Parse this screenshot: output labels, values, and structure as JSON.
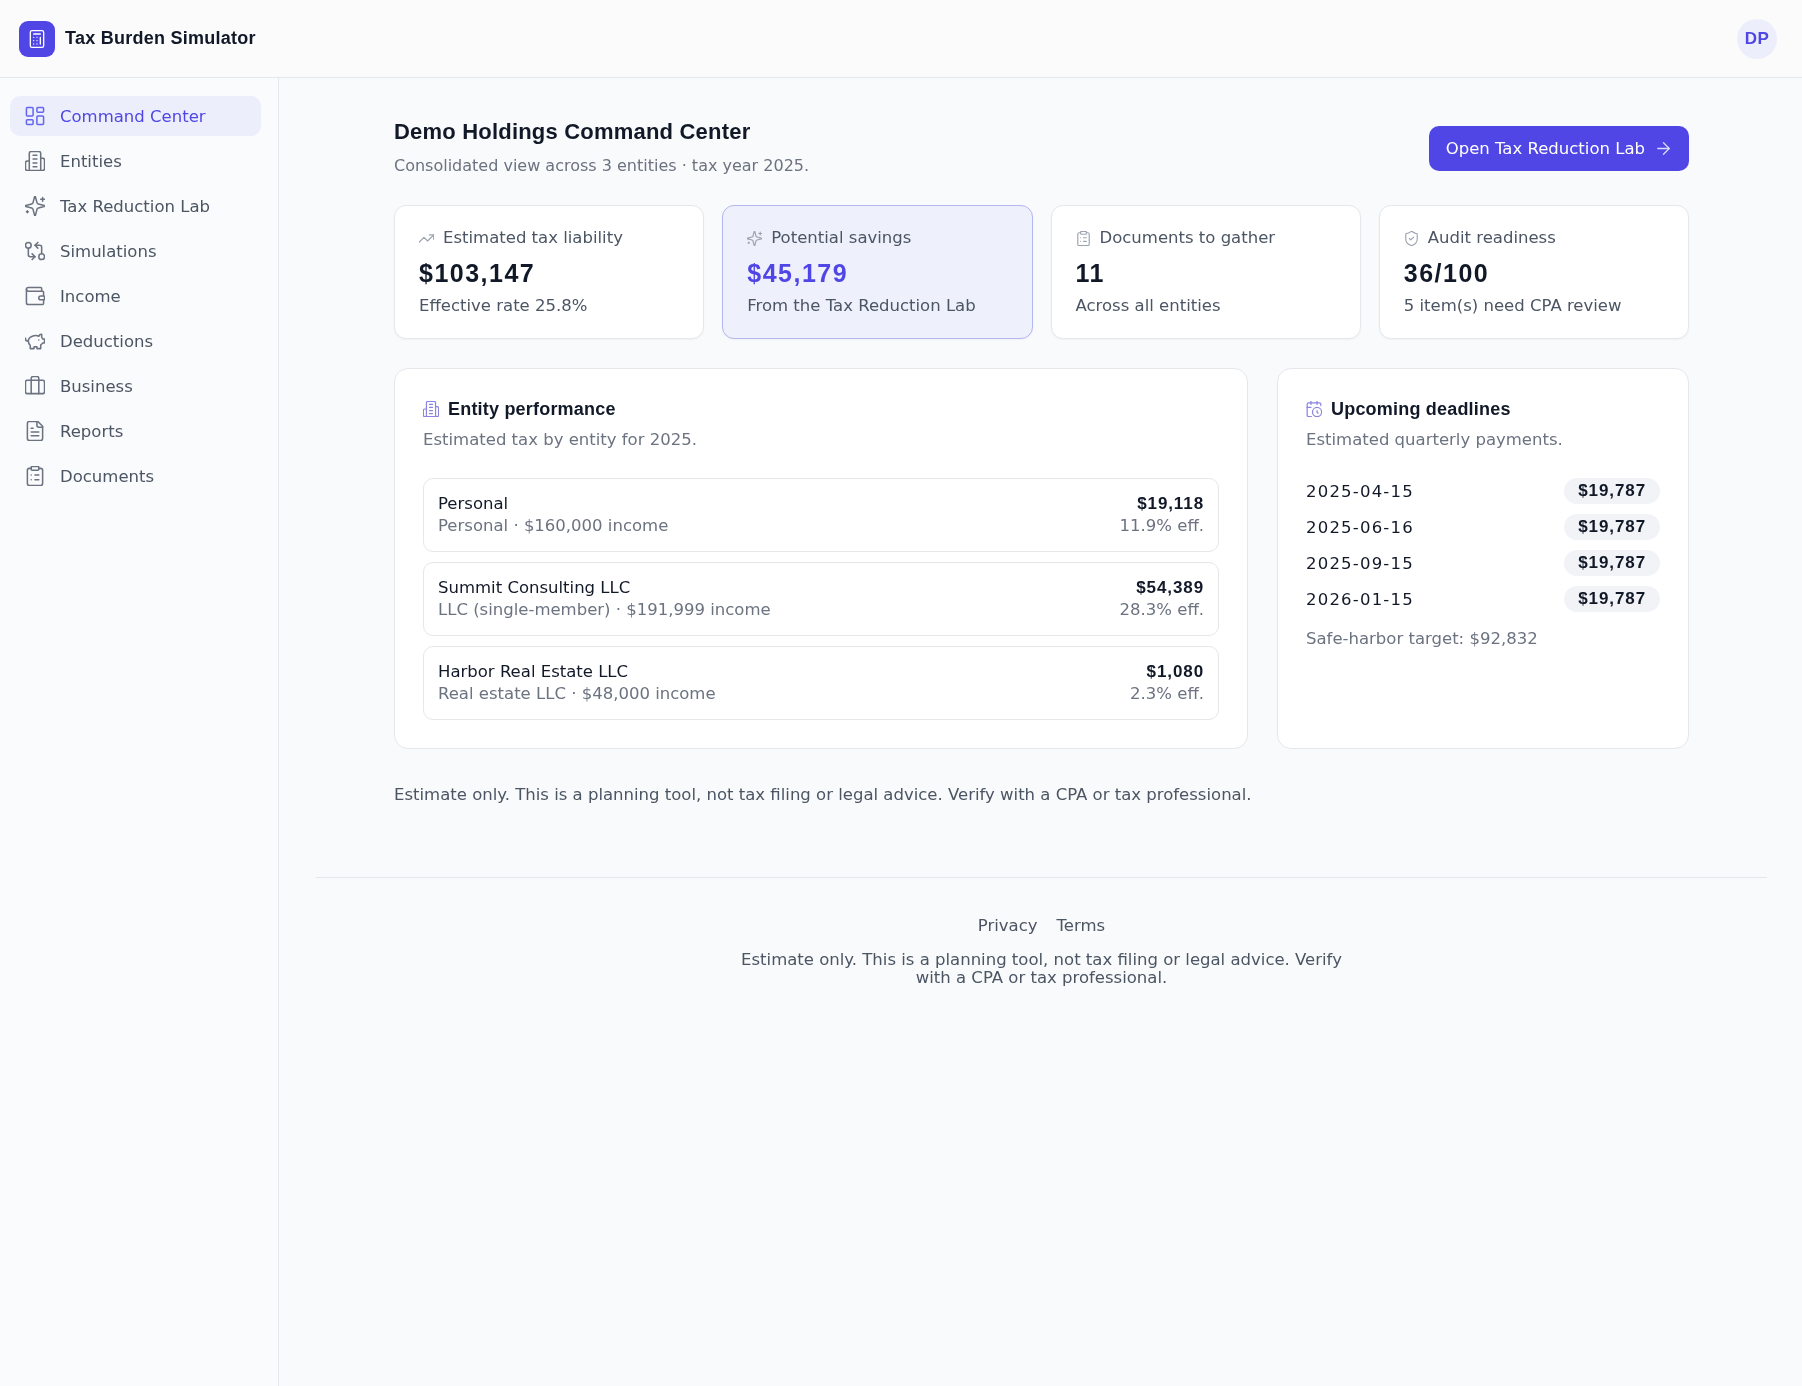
{
  "header": {
    "app_title": "Tax Burden Simulator",
    "avatar_initials": "DP"
  },
  "sidebar": {
    "items": [
      {
        "label": "Command Center",
        "selected": true
      },
      {
        "label": "Entities",
        "selected": false
      },
      {
        "label": "Tax Reduction Lab",
        "selected": false
      },
      {
        "label": "Simulations",
        "selected": false
      },
      {
        "label": "Income",
        "selected": false
      },
      {
        "label": "Deductions",
        "selected": false
      },
      {
        "label": "Business",
        "selected": false
      },
      {
        "label": "Reports",
        "selected": false
      },
      {
        "label": "Documents",
        "selected": false
      }
    ]
  },
  "page": {
    "title": "Demo Holdings Command Center",
    "subtitle": "Consolidated view across 3 entities · tax year 2025.",
    "primary_button": "Open Tax Reduction Lab"
  },
  "stat_cards": [
    {
      "label": "Estimated tax liability",
      "value": "$103,147",
      "note": "Effective rate 25.8%",
      "highlighted": false
    },
    {
      "label": "Potential savings",
      "value": "$45,179",
      "note": "From the Tax Reduction Lab",
      "highlighted": true
    },
    {
      "label": "Documents to gather",
      "value": "11",
      "note": "Across all entities",
      "highlighted": false
    },
    {
      "label": "Audit readiness",
      "value": "36/100",
      "note": "5 item(s) need CPA review",
      "highlighted": false
    }
  ],
  "entity_performance": {
    "title": "Entity performance",
    "subtitle": "Estimated tax by entity for 2025.",
    "rows": [
      {
        "name": "Personal",
        "detail": "Personal · $160,000 income",
        "tax": "$19,118",
        "rate": "11.9% eff."
      },
      {
        "name": "Summit Consulting LLC",
        "detail": "LLC (single-member) · $191,999 income",
        "tax": "$54,389",
        "rate": "28.3% eff."
      },
      {
        "name": "Harbor Real Estate LLC",
        "detail": "Real estate LLC · $48,000 income",
        "tax": "$1,080",
        "rate": "2.3% eff."
      }
    ]
  },
  "upcoming_deadlines": {
    "title": "Upcoming deadlines",
    "subtitle": "Estimated quarterly payments.",
    "payments": [
      {
        "date": "2025-04-15",
        "amount": "$19,787"
      },
      {
        "date": "2025-06-16",
        "amount": "$19,787"
      },
      {
        "date": "2025-09-15",
        "amount": "$19,787"
      },
      {
        "date": "2026-01-15",
        "amount": "$19,787"
      }
    ],
    "note": "Safe-harbor target: $92,832"
  },
  "disclaimer": "Estimate only. This is a planning tool, not tax filing or legal advice. Verify with a CPA or tax professional.",
  "footer": {
    "links": [
      "Privacy",
      "Terms"
    ],
    "disclaimer": "Estimate only. This is a planning tool, not tax filing or legal advice. Verify with a CPA or tax professional."
  }
}
